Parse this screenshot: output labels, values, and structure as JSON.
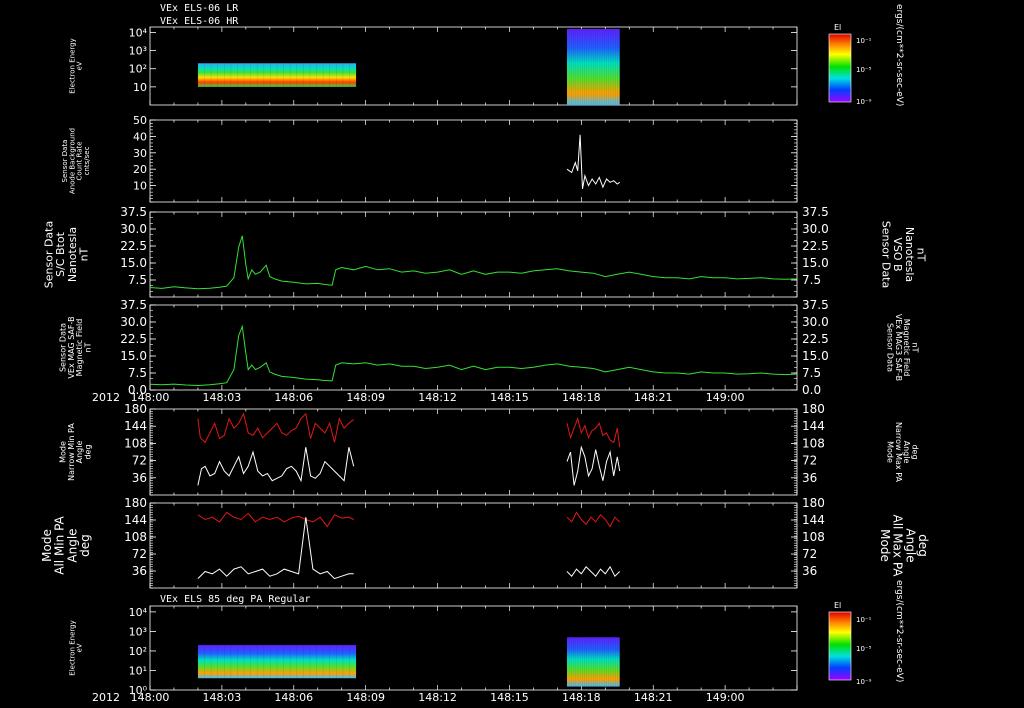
{
  "header": {
    "line1": "VEx ELS-06 LR",
    "line2": "VEx ELS-06 HR"
  },
  "colors": {
    "background": "#000000",
    "axis": "#ffffff",
    "green_series": "#35e035",
    "red_series": "#e01818",
    "white_series": "#ffffff"
  },
  "time_axis": {
    "year": "2012",
    "tick_labels": [
      "148:00",
      "148:03",
      "148:06",
      "148:09",
      "148:12",
      "148:15",
      "148:18",
      "148:21",
      "149:00"
    ],
    "range_minutes": [
      0,
      27
    ]
  },
  "chart_data": [
    {
      "type": "heatmap",
      "id": "energy_lr_hr",
      "title": "VEx ELS-06 LR / VEx ELS-06 HR",
      "ylabel": [
        "Electron Energy",
        "eV"
      ],
      "yscale": "log",
      "ylim": [
        1,
        20000
      ],
      "y_tick_labels": [
        "10⁴",
        "10³",
        "10²",
        "10"
      ],
      "colorbar": {
        "label": "El",
        "units": "ergs/(cm**2-sr-sec-eV)",
        "tick_labels": [
          "10⁻¹",
          "10⁻⁵",
          "10⁻⁹"
        ]
      },
      "data_intervals_minutes": [
        [
          2.0,
          8.6
        ],
        [
          17.4,
          19.6
        ]
      ]
    },
    {
      "type": "line",
      "id": "anode_background",
      "ylabel": [
        "Sensor Data",
        "Anode Background",
        "Count Rate",
        "cnts/sec"
      ],
      "ylim": [
        0,
        50
      ],
      "y_tick_labels": [
        "50",
        "40",
        "30",
        "20",
        "10"
      ],
      "series": [
        {
          "color": "#ffffff",
          "x": [
            17.4,
            17.6,
            17.75,
            17.85,
            17.95,
            18.05,
            18.15,
            18.3,
            18.45,
            18.6,
            18.75,
            18.9,
            19.05,
            19.2,
            19.35,
            19.5,
            19.6
          ],
          "y": [
            20,
            18,
            24,
            19,
            41,
            8,
            16,
            10,
            14,
            11,
            15,
            9,
            14,
            12,
            13,
            11,
            12
          ]
        }
      ]
    },
    {
      "type": "line",
      "id": "sc_bmag",
      "ylabel": [
        "Sensor Data",
        "S/C Btot",
        "Nanotesla",
        "nT"
      ],
      "ylabel_right": [
        "Sensor Data",
        "VSO B",
        "Nanotesla",
        "nT"
      ],
      "ylim": [
        0,
        37.5
      ],
      "y_tick_labels": [
        "37.5",
        "30.0",
        "22.5",
        "15.0",
        "7.5"
      ],
      "series": [
        {
          "color": "#35e035",
          "x": [
            0,
            0.5,
            1,
            1.5,
            2,
            2.5,
            2.9,
            3.2,
            3.5,
            3.7,
            3.85,
            4.0,
            4.1,
            4.25,
            4.4,
            4.6,
            4.85,
            5.0,
            5.2,
            5.5,
            6.0,
            6.5,
            7.0,
            7.3,
            7.6,
            7.75,
            8.0,
            8.5,
            9.0,
            9.5,
            10,
            10.5,
            11,
            11.5,
            12,
            12.5,
            13,
            13.5,
            14,
            14.5,
            15,
            15.5,
            16,
            16.5,
            17,
            17.5,
            18,
            18.5,
            19,
            19.5,
            20,
            20.5,
            21,
            21.5,
            22,
            22.5,
            23,
            23.5,
            24,
            24.5,
            25,
            25.5,
            26,
            26.5,
            27
          ],
          "y": [
            4.2,
            3.8,
            4.5,
            4.0,
            3.6,
            3.9,
            4.3,
            4.8,
            8.5,
            22,
            27,
            14,
            8,
            12,
            10,
            11,
            14,
            9,
            8,
            7,
            6.5,
            5.8,
            6.0,
            5.5,
            5.2,
            12,
            13,
            12,
            13.5,
            12,
            12.5,
            11,
            11.5,
            10.5,
            11,
            12,
            10,
            11.5,
            10,
            11,
            11,
            10.5,
            11.5,
            12,
            12.5,
            11.5,
            11,
            10.5,
            9,
            10,
            11,
            10,
            9,
            8.5,
            8.5,
            8,
            9,
            8.5,
            8.5,
            8,
            8.2,
            8.5,
            8,
            7.8,
            8
          ]
        }
      ]
    },
    {
      "type": "line",
      "id": "mag_saf_b",
      "ylabel": [
        "Sensor Data",
        "VEx MAG SAF-B",
        "Magnetic Field",
        "nT"
      ],
      "ylabel_right": [
        "Sensor Data",
        "VEx MAG3 SAF-B",
        "Magnetic Field",
        "nT"
      ],
      "ylim": [
        0,
        37.5
      ],
      "y_tick_labels": [
        "37.5",
        "30.0",
        "22.5",
        "15.0",
        "7.5",
        "0.0"
      ],
      "series": [
        {
          "color": "#35e035",
          "x": [
            0,
            0.5,
            1,
            1.5,
            2,
            2.5,
            2.9,
            3.2,
            3.5,
            3.7,
            3.85,
            4.0,
            4.1,
            4.25,
            4.4,
            4.6,
            4.85,
            5.0,
            5.2,
            5.5,
            6.0,
            6.5,
            7.0,
            7.3,
            7.6,
            7.75,
            8.0,
            8.5,
            9.0,
            9.5,
            10,
            10.5,
            11,
            11.5,
            12,
            12.5,
            13,
            13.5,
            14,
            14.5,
            15,
            15.5,
            16,
            16.5,
            17,
            17.5,
            18,
            18.5,
            19,
            19.5,
            20,
            20.5,
            21,
            21.5,
            22,
            22.5,
            23,
            23.5,
            24,
            24.5,
            25,
            25.5,
            26,
            26.5,
            27
          ],
          "y": [
            2.5,
            2.3,
            2.6,
            2.2,
            2.0,
            2.3,
            2.8,
            3.2,
            9,
            24,
            28,
            16,
            9,
            11,
            9,
            10,
            12,
            8,
            7,
            6,
            5.5,
            4.8,
            4.5,
            4.2,
            4.0,
            11,
            12,
            11.5,
            12,
            11,
            11.5,
            10.5,
            10.5,
            9.5,
            10,
            11,
            9,
            10.5,
            9,
            10,
            10,
            9.5,
            10,
            11,
            11.5,
            10.5,
            10,
            9.5,
            8,
            9,
            10,
            9,
            8,
            7.5,
            7.5,
            7,
            8,
            7.5,
            7.5,
            7,
            7.2,
            7.5,
            7,
            6.8,
            7
          ]
        }
      ]
    },
    {
      "type": "line",
      "id": "narrow_pa",
      "ylabel": [
        "Mode",
        "Narrow Min PA",
        "Angle",
        "deg"
      ],
      "ylabel_right": [
        "Mode",
        "Narrow Max PA",
        "Angle",
        "deg"
      ],
      "ylim": [
        0,
        180
      ],
      "y_tick_labels": [
        "180",
        "144",
        "108",
        "72",
        "36"
      ],
      "series": [
        {
          "name": "Narrow Max PA",
          "color": "#e01818",
          "x": [
            2.0,
            2.1,
            2.3,
            2.5,
            2.7,
            2.9,
            3.1,
            3.3,
            3.5,
            3.7,
            3.9,
            4.1,
            4.3,
            4.5,
            4.7,
            4.9,
            5.1,
            5.3,
            5.5,
            5.7,
            5.9,
            6.1,
            6.3,
            6.5,
            6.7,
            6.9,
            7.1,
            7.3,
            7.5,
            7.7,
            7.9,
            8.1,
            8.3,
            8.5
          ],
          "y": [
            160,
            120,
            110,
            130,
            150,
            118,
            125,
            160,
            140,
            150,
            170,
            130,
            125,
            140,
            120,
            130,
            140,
            150,
            130,
            125,
            135,
            140,
            160,
            170,
            118,
            150,
            140,
            130,
            150,
            110,
            160,
            140,
            150,
            158
          ]
        },
        {
          "name": "Narrow Min PA",
          "color": "#ffffff",
          "x": [
            2.0,
            2.15,
            2.3,
            2.5,
            2.7,
            2.9,
            3.1,
            3.3,
            3.5,
            3.7,
            3.9,
            4.1,
            4.3,
            4.5,
            4.7,
            4.9,
            5.1,
            5.3,
            5.5,
            5.7,
            5.9,
            6.1,
            6.3,
            6.5,
            6.7,
            6.9,
            7.1,
            7.3,
            7.5,
            7.7,
            7.9,
            8.1,
            8.3,
            8.5
          ],
          "y": [
            20,
            55,
            60,
            40,
            45,
            70,
            50,
            40,
            60,
            80,
            45,
            60,
            90,
            50,
            40,
            45,
            30,
            35,
            40,
            55,
            60,
            50,
            30,
            100,
            40,
            35,
            45,
            70,
            60,
            50,
            40,
            30,
            100,
            60
          ]
        },
        {
          "name": "Narrow Max PA",
          "color": "#e01818",
          "x": [
            17.4,
            17.55,
            17.7,
            17.85,
            18.0,
            18.15,
            18.3,
            18.45,
            18.6,
            18.75,
            18.9,
            19.05,
            19.2,
            19.35,
            19.5,
            19.6
          ],
          "y": [
            150,
            120,
            140,
            160,
            130,
            145,
            120,
            135,
            140,
            150,
            125,
            130,
            115,
            110,
            140,
            100
          ]
        },
        {
          "name": "Narrow Min PA",
          "color": "#ffffff",
          "x": [
            17.4,
            17.55,
            17.7,
            17.85,
            18.0,
            18.15,
            18.3,
            18.45,
            18.6,
            18.75,
            18.9,
            19.05,
            19.2,
            19.35,
            19.5,
            19.6
          ],
          "y": [
            70,
            90,
            20,
            50,
            100,
            80,
            40,
            55,
            95,
            60,
            30,
            70,
            90,
            40,
            80,
            50
          ]
        }
      ]
    },
    {
      "type": "line",
      "id": "all_pa",
      "ylabel": [
        "Mode",
        "All Min PA",
        "Angle",
        "deg"
      ],
      "ylabel_right": [
        "Mode",
        "All Max PA",
        "Angle",
        "deg"
      ],
      "ylim": [
        0,
        180
      ],
      "y_tick_labels": [
        "180",
        "144",
        "108",
        "72",
        "36"
      ],
      "series": [
        {
          "name": "All Max PA",
          "color": "#e01818",
          "x": [
            2.0,
            2.3,
            2.6,
            2.9,
            3.2,
            3.5,
            3.8,
            4.1,
            4.4,
            4.7,
            5.0,
            5.3,
            5.6,
            5.9,
            6.2,
            6.5,
            6.8,
            7.1,
            7.4,
            7.7,
            8.0,
            8.3,
            8.5
          ],
          "y": [
            155,
            145,
            150,
            140,
            160,
            150,
            145,
            158,
            140,
            150,
            145,
            150,
            140,
            148,
            152,
            145,
            140,
            150,
            130,
            155,
            148,
            150,
            145
          ]
        },
        {
          "name": "All Min PA",
          "color": "#ffffff",
          "x": [
            2.0,
            2.3,
            2.6,
            2.9,
            3.2,
            3.5,
            3.8,
            4.1,
            4.4,
            4.7,
            5.0,
            5.3,
            5.6,
            5.9,
            6.2,
            6.5,
            6.8,
            7.1,
            7.4,
            7.7,
            8.0,
            8.3,
            8.5
          ],
          "y": [
            20,
            35,
            30,
            40,
            25,
            40,
            45,
            30,
            35,
            40,
            25,
            30,
            40,
            35,
            30,
            150,
            40,
            30,
            35,
            20,
            25,
            30,
            30
          ]
        },
        {
          "name": "All Max PA",
          "color": "#e01818",
          "x": [
            17.4,
            17.6,
            17.8,
            18.0,
            18.2,
            18.4,
            18.6,
            18.8,
            19.0,
            19.2,
            19.4,
            19.6
          ],
          "y": [
            150,
            140,
            160,
            145,
            135,
            150,
            140,
            155,
            145,
            130,
            150,
            140
          ]
        },
        {
          "name": "All Min PA",
          "color": "#ffffff",
          "x": [
            17.4,
            17.6,
            17.8,
            18.0,
            18.2,
            18.4,
            18.6,
            18.8,
            19.0,
            19.2,
            19.4,
            19.6
          ],
          "y": [
            35,
            25,
            40,
            30,
            45,
            35,
            25,
            40,
            30,
            45,
            25,
            35
          ]
        }
      ]
    },
    {
      "type": "heatmap",
      "id": "energy_85deg",
      "title": "VEx ELS 85 deg PA Regular",
      "ylabel": [
        "Electron Energy",
        "eV"
      ],
      "yscale": "log",
      "ylim": [
        1,
        20000
      ],
      "y_tick_labels": [
        "10⁴",
        "10³",
        "10²",
        "10¹",
        "10⁰"
      ],
      "colorbar": {
        "label": "El",
        "units": "ergs/(cm**2-sr-sec-eV)",
        "tick_labels": [
          "10⁻¹",
          "10⁻⁵",
          "10⁻⁹"
        ]
      },
      "data_intervals_minutes": [
        [
          2.0,
          8.6
        ],
        [
          17.4,
          19.6
        ]
      ]
    }
  ]
}
